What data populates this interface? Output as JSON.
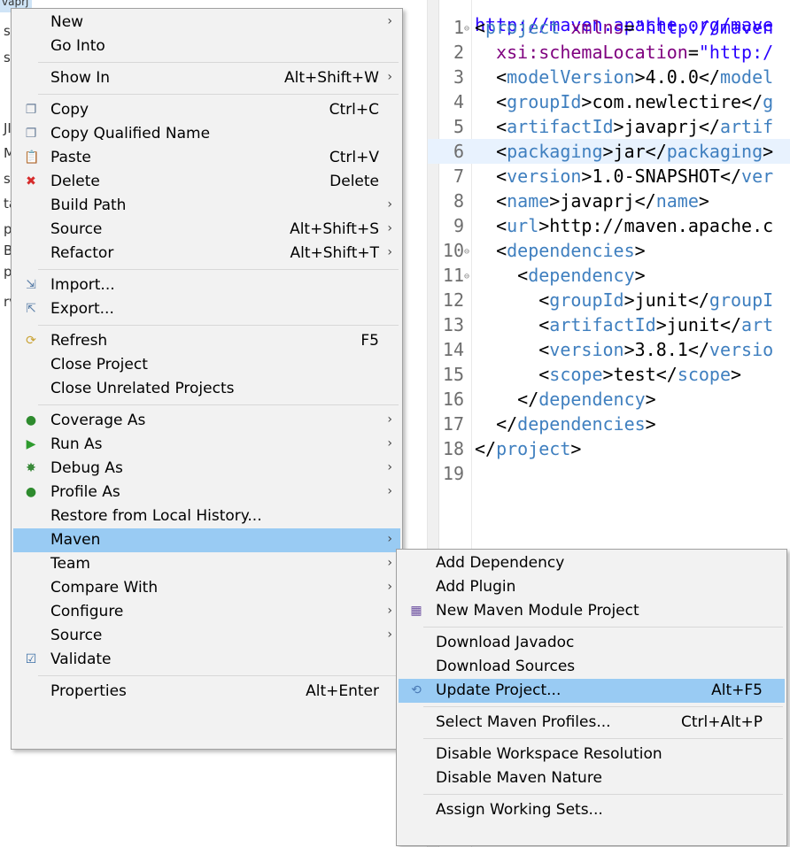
{
  "explorer": {
    "selected_label": "vaprj",
    "stubs": [
      "s",
      "s",
      "JI",
      "M",
      "s",
      "ta",
      "p",
      "Bo",
      "pp",
      "rv"
    ]
  },
  "editor": {
    "top_partial": "http://maven.apache.org/mave",
    "lines": [
      {
        "n": "1",
        "fold": true,
        "code": [
          [
            "b",
            "<"
          ],
          [
            "tag",
            "project"
          ],
          [
            "txt",
            " "
          ],
          [
            "attr",
            "xmlns"
          ],
          [
            "txt",
            "="
          ],
          [
            "val",
            "\"http://maven"
          ]
        ]
      },
      {
        "n": "2",
        "code": [
          [
            "txt",
            "  "
          ],
          [
            "attr",
            "xsi:schemaLocation"
          ],
          [
            "txt",
            "="
          ],
          [
            "val",
            "\"http:/"
          ]
        ]
      },
      {
        "n": "3",
        "code": [
          [
            "txt",
            "  <"
          ],
          [
            "tag",
            "modelVersion"
          ],
          [
            "txt",
            ">4.0.0</"
          ],
          [
            "tag",
            "model"
          ]
        ]
      },
      {
        "n": "4",
        "code": [
          [
            "txt",
            "  <"
          ],
          [
            "tag",
            "groupId"
          ],
          [
            "txt",
            ">com.newlectire</"
          ],
          [
            "tag",
            "g"
          ]
        ]
      },
      {
        "n": "5",
        "code": [
          [
            "txt",
            "  <"
          ],
          [
            "tag",
            "artifactId"
          ],
          [
            "txt",
            ">javaprj</"
          ],
          [
            "tag",
            "artif"
          ]
        ]
      },
      {
        "n": "6",
        "hl": true,
        "code": [
          [
            "txt",
            "  <"
          ],
          [
            "tag",
            "packaging"
          ],
          [
            "txt",
            ">jar</"
          ],
          [
            "tag",
            "packaging"
          ],
          [
            "txt",
            ">"
          ]
        ]
      },
      {
        "n": "7",
        "code": [
          [
            "txt",
            "  <"
          ],
          [
            "tag",
            "version"
          ],
          [
            "txt",
            ">1.0-SNAPSHOT</"
          ],
          [
            "tag",
            "ver"
          ]
        ]
      },
      {
        "n": "8",
        "code": [
          [
            "txt",
            "  <"
          ],
          [
            "tag",
            "name"
          ],
          [
            "txt",
            ">javaprj</"
          ],
          [
            "tag",
            "name"
          ],
          [
            "txt",
            ">"
          ]
        ]
      },
      {
        "n": "9",
        "code": [
          [
            "txt",
            "  <"
          ],
          [
            "tag",
            "url"
          ],
          [
            "txt",
            ">http://maven.apache.c"
          ]
        ]
      },
      {
        "n": "10",
        "fold": true,
        "code": [
          [
            "txt",
            "  <"
          ],
          [
            "tag",
            "dependencies"
          ],
          [
            "txt",
            ">"
          ]
        ]
      },
      {
        "n": "11",
        "fold": true,
        "code": [
          [
            "txt",
            "    <"
          ],
          [
            "tag",
            "dependency"
          ],
          [
            "txt",
            ">"
          ]
        ]
      },
      {
        "n": "12",
        "code": [
          [
            "txt",
            "      <"
          ],
          [
            "tag",
            "groupId"
          ],
          [
            "txt",
            ">junit</"
          ],
          [
            "tag",
            "groupI"
          ]
        ]
      },
      {
        "n": "13",
        "code": [
          [
            "txt",
            "      <"
          ],
          [
            "tag",
            "artifactId"
          ],
          [
            "txt",
            ">junit</"
          ],
          [
            "tag",
            "art"
          ]
        ]
      },
      {
        "n": "14",
        "code": [
          [
            "txt",
            "      <"
          ],
          [
            "tag",
            "version"
          ],
          [
            "txt",
            ">3.8.1</"
          ],
          [
            "tag",
            "versio"
          ]
        ]
      },
      {
        "n": "15",
        "code": [
          [
            "txt",
            "      <"
          ],
          [
            "tag",
            "scope"
          ],
          [
            "txt",
            ">test</"
          ],
          [
            "tag",
            "scope"
          ],
          [
            "txt",
            ">"
          ]
        ]
      },
      {
        "n": "16",
        "code": [
          [
            "txt",
            "    </"
          ],
          [
            "tag",
            "dependency"
          ],
          [
            "txt",
            ">"
          ]
        ]
      },
      {
        "n": "17",
        "code": [
          [
            "txt",
            "  </"
          ],
          [
            "tag",
            "dependencies"
          ],
          [
            "txt",
            ">"
          ]
        ]
      },
      {
        "n": "18",
        "code": [
          [
            "txt",
            "</"
          ],
          [
            "tag",
            "project"
          ],
          [
            "txt",
            ">"
          ]
        ]
      },
      {
        "n": "19",
        "code": []
      }
    ]
  },
  "context_menu": {
    "items": [
      {
        "label": "New",
        "submenu": true
      },
      {
        "label": "Go Into"
      },
      {
        "sep": true
      },
      {
        "label": "Show In",
        "shortcut": "Alt+Shift+W",
        "submenu": true
      },
      {
        "sep": true
      },
      {
        "label": "Copy",
        "shortcut": "Ctrl+C",
        "icon": "copy-icon"
      },
      {
        "label": "Copy Qualified Name",
        "icon": "copy-qualified-icon"
      },
      {
        "label": "Paste",
        "shortcut": "Ctrl+V",
        "icon": "paste-icon"
      },
      {
        "label": "Delete",
        "shortcut": "Delete",
        "icon": "delete-icon"
      },
      {
        "label": "Build Path",
        "submenu": true
      },
      {
        "label": "Source",
        "shortcut": "Alt+Shift+S",
        "submenu": true
      },
      {
        "label": "Refactor",
        "shortcut": "Alt+Shift+T",
        "submenu": true
      },
      {
        "sep": true
      },
      {
        "label": "Import...",
        "icon": "import-icon"
      },
      {
        "label": "Export...",
        "icon": "export-icon"
      },
      {
        "sep": true
      },
      {
        "label": "Refresh",
        "shortcut": "F5",
        "icon": "refresh-icon"
      },
      {
        "label": "Close Project"
      },
      {
        "label": "Close Unrelated Projects"
      },
      {
        "sep": true
      },
      {
        "label": "Coverage As",
        "submenu": true,
        "icon": "coverage-icon"
      },
      {
        "label": "Run As",
        "submenu": true,
        "icon": "run-icon"
      },
      {
        "label": "Debug As",
        "submenu": true,
        "icon": "debug-icon"
      },
      {
        "label": "Profile As",
        "submenu": true,
        "icon": "profile-icon"
      },
      {
        "label": "Restore from Local History..."
      },
      {
        "label": "Maven",
        "submenu": true,
        "active": true
      },
      {
        "label": "Team",
        "submenu": true
      },
      {
        "label": "Compare With",
        "submenu": true
      },
      {
        "label": "Configure",
        "submenu": true
      },
      {
        "label": "Source",
        "submenu": true
      },
      {
        "label": "Validate",
        "icon": "check-icon"
      },
      {
        "sep": true
      },
      {
        "label": "Properties",
        "shortcut": "Alt+Enter"
      }
    ]
  },
  "maven_menu": {
    "items": [
      {
        "label": "Add Dependency"
      },
      {
        "label": "Add Plugin"
      },
      {
        "label": "New Maven Module Project",
        "icon": "maven-module-icon"
      },
      {
        "sep": true
      },
      {
        "label": "Download Javadoc"
      },
      {
        "label": "Download Sources"
      },
      {
        "label": "Update Project...",
        "shortcut": "Alt+F5",
        "icon": "update-project-icon",
        "active": true
      },
      {
        "sep": true
      },
      {
        "label": "Select Maven Profiles...",
        "shortcut": "Ctrl+Alt+P"
      },
      {
        "sep": true
      },
      {
        "label": "Disable Workspace Resolution"
      },
      {
        "label": "Disable Maven Nature"
      },
      {
        "sep": true
      },
      {
        "label": "Assign Working Sets..."
      }
    ]
  },
  "icon_glyphs": {
    "copy-icon": "❐",
    "copy-qualified-icon": "❐",
    "paste-icon": "📋",
    "delete-icon": "✖",
    "import-icon": "⇲",
    "export-icon": "⇱",
    "refresh-icon": "⟳",
    "coverage-icon": "●",
    "run-icon": "▶",
    "debug-icon": "✸",
    "profile-icon": "●",
    "check-icon": "☑",
    "maven-module-icon": "▦",
    "update-project-icon": "⟲"
  },
  "icon_colors": {
    "copy-icon": "#6a7f9a",
    "copy-qualified-icon": "#6a7f9a",
    "paste-icon": "#b08a3c",
    "delete-icon": "#d62b2b",
    "import-icon": "#5b7fa8",
    "export-icon": "#5b7fa8",
    "refresh-icon": "#c9a232",
    "coverage-icon": "#2e8b2e",
    "run-icon": "#2e9b2e",
    "debug-icon": "#3a8a3a",
    "profile-icon": "#2e8b2e",
    "check-icon": "#3a6ea5",
    "maven-module-icon": "#6c4fa0",
    "update-project-icon": "#4a7ab5"
  }
}
